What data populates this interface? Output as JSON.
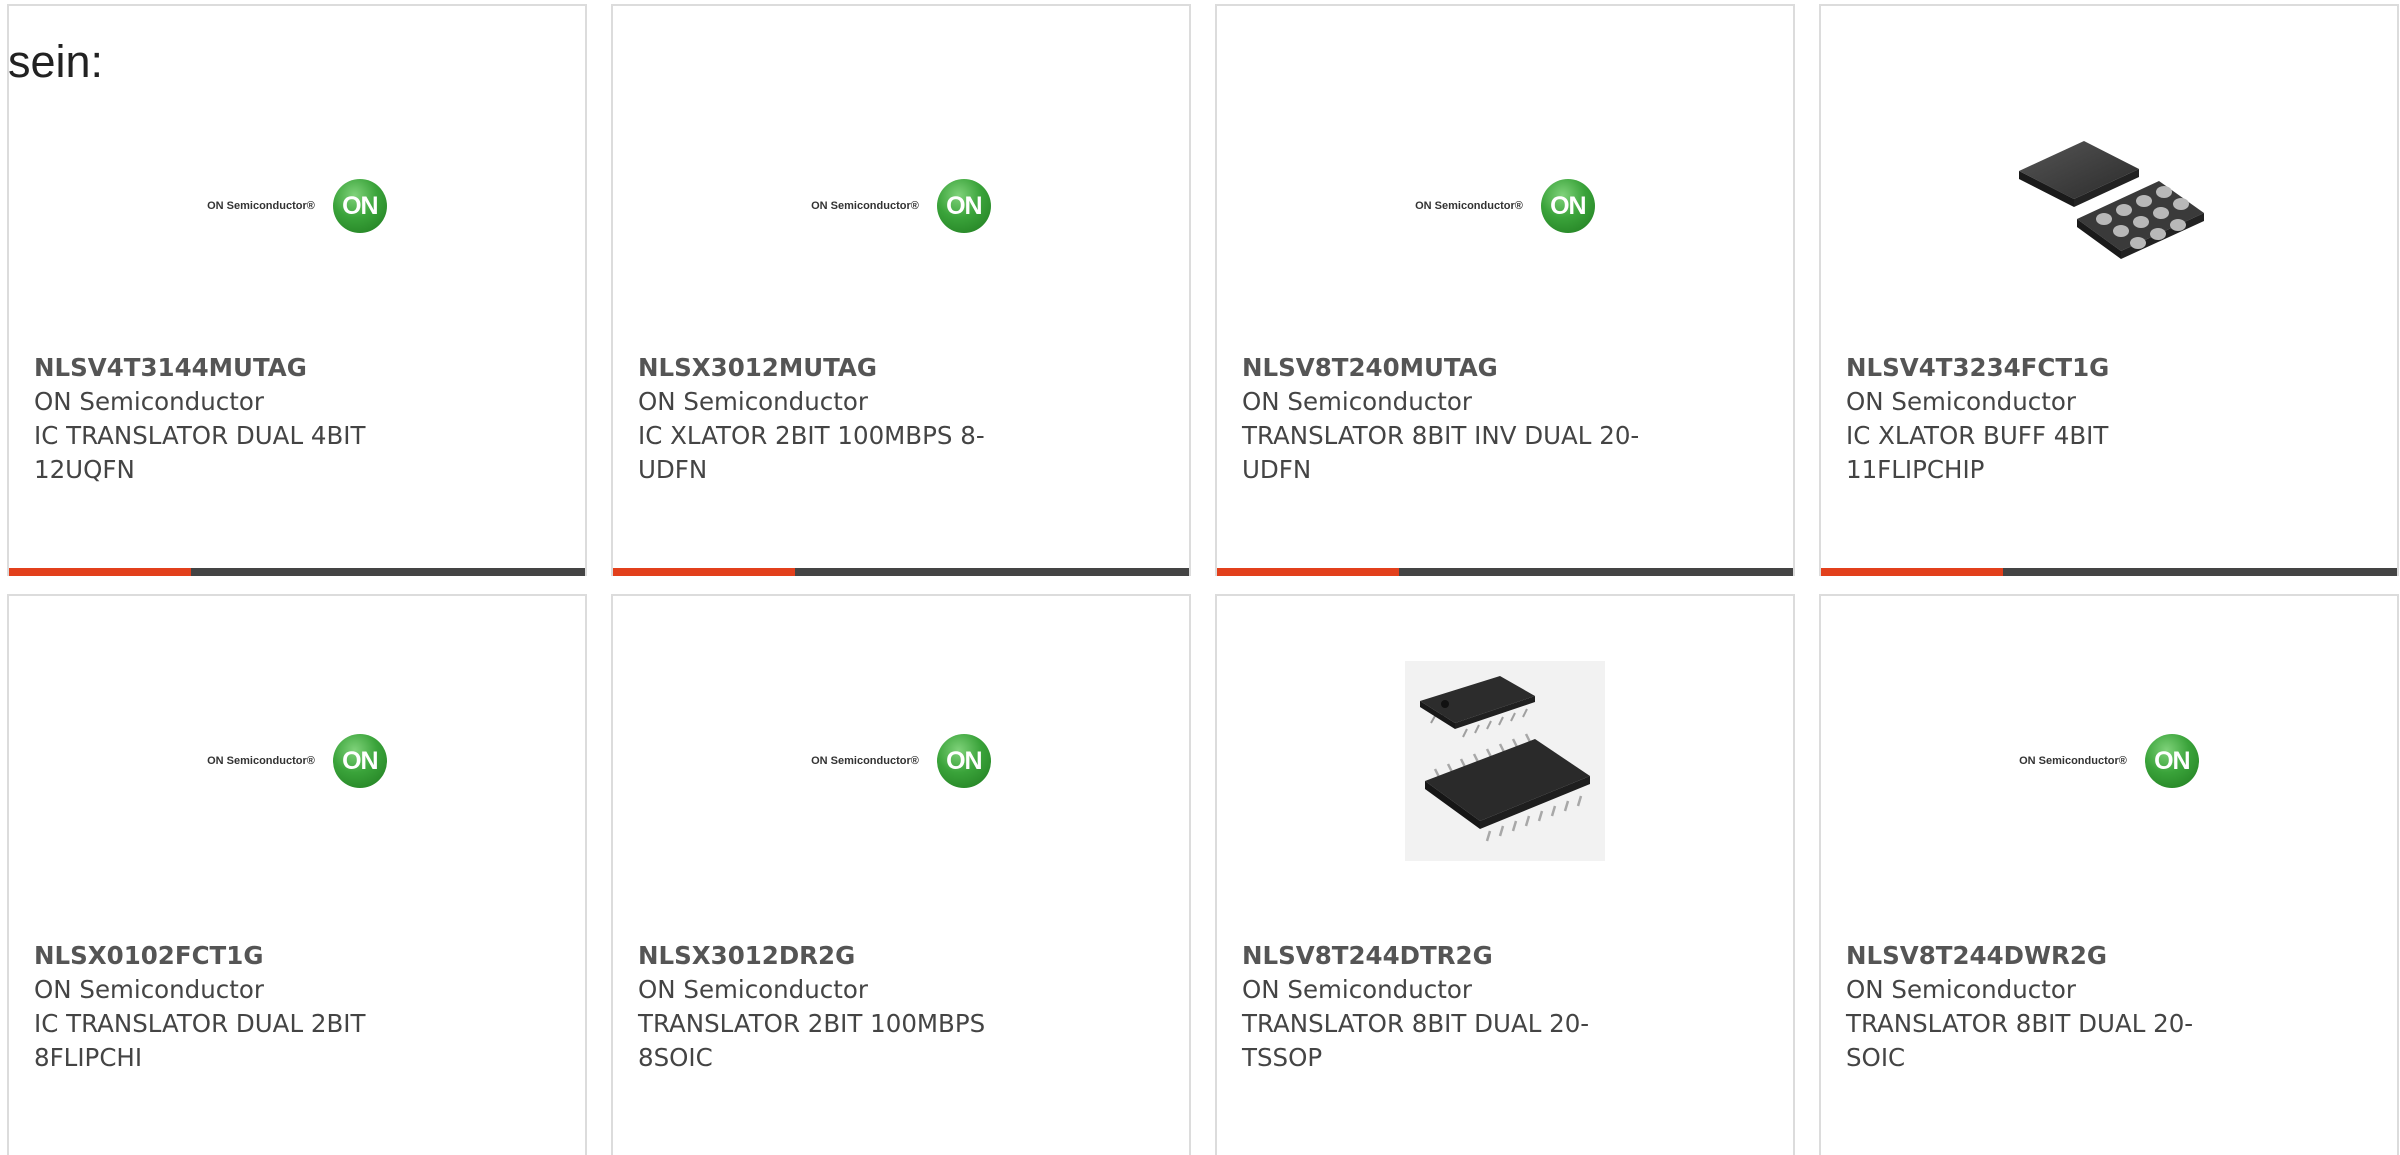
{
  "intro_text": "sein:",
  "products": [
    {
      "part_number": "NLSV4T3144MUTAG",
      "manufacturer": "ON Semiconductor",
      "description_line1": "IC TRANSLATOR DUAL 4BIT",
      "description_line2": "12UQFN",
      "image": "on-semiconductor-logo"
    },
    {
      "part_number": "NLSX3012MUTAG",
      "manufacturer": "ON Semiconductor",
      "description_line1": "IC XLATOR 2BIT 100MBPS 8-",
      "description_line2": "UDFN",
      "image": "on-semiconductor-logo"
    },
    {
      "part_number": "NLSV8T240MUTAG",
      "manufacturer": "ON Semiconductor",
      "description_line1": "TRANSLATOR 8BIT INV DUAL 20-",
      "description_line2": "UDFN",
      "image": "on-semiconductor-logo"
    },
    {
      "part_number": "NLSV4T3234FCT1G",
      "manufacturer": "ON Semiconductor",
      "description_line1": "IC XLATOR BUFF 4BIT",
      "description_line2": "11FLIPCHIP",
      "image": "bga-chip-photo"
    },
    {
      "part_number": "NLSX0102FCT1G",
      "manufacturer": "ON Semiconductor",
      "description_line1": "IC TRANSLATOR DUAL 2BIT",
      "description_line2": "8FLIPCHI",
      "image": "on-semiconductor-logo"
    },
    {
      "part_number": "NLSX3012DR2G",
      "manufacturer": "ON Semiconductor",
      "description_line1": "TRANSLATOR 2BIT 100MBPS",
      "description_line2": "8SOIC",
      "image": "on-semiconductor-logo"
    },
    {
      "part_number": "NLSV8T244DTR2G",
      "manufacturer": "ON Semiconductor",
      "description_line1": "TRANSLATOR 8BIT DUAL 20-",
      "description_line2": "TSSOP",
      "image": "tssop-chip-photo"
    },
    {
      "part_number": "NLSV8T244DWR2G",
      "manufacturer": "ON Semiconductor",
      "description_line1": "TRANSLATOR 8BIT DUAL 20-",
      "description_line2": "SOIC",
      "image": "on-semiconductor-logo"
    }
  ],
  "logo": {
    "wordmark": "ON Semiconductor®",
    "badge": "ON"
  },
  "colors": {
    "accent_orange": "#e2401c",
    "accent_dark": "#444444",
    "on_green": "#3aa33a"
  }
}
